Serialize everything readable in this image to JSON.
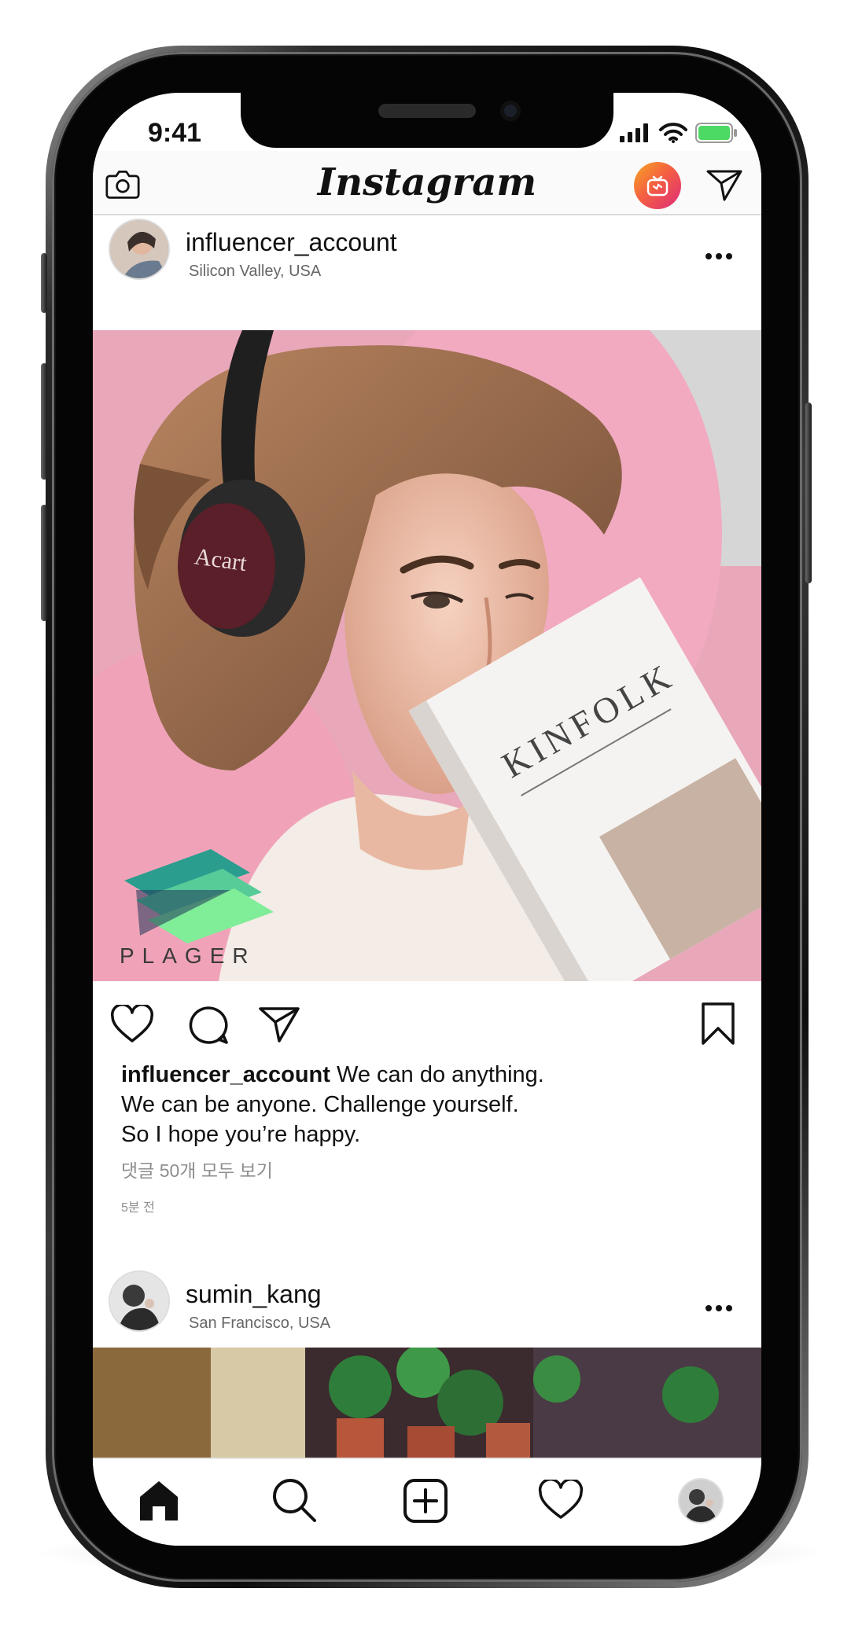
{
  "status_bar": {
    "time": "9:41"
  },
  "top_bar": {
    "logo": "Instagram",
    "icons": [
      "camera-icon",
      "igtv-icon",
      "direct-icon"
    ]
  },
  "post1": {
    "username": "influencer_account",
    "location": "Silicon Valley, USA",
    "more": "•••",
    "photo_text": {
      "headphone_brand": "Acart",
      "magazine": "KINFOLK",
      "watermark": "PLAGER"
    },
    "caption_user": "influencer_account",
    "caption_line1": "We can do anything.",
    "caption_line2": "We can be anyone. Challenge yourself.",
    "caption_line3": "So I hope you’re happy.",
    "comments_link": "댓글 50개 모두 보기",
    "time_ago": "5분 전"
  },
  "post2": {
    "username": "sumin_kang",
    "location": "San Francisco, USA",
    "more": "•••"
  },
  "tab_bar": {
    "items": [
      "home-icon",
      "search-icon",
      "new-post-icon",
      "activity-heart-icon",
      "profile-avatar"
    ]
  },
  "colors": {
    "igtv_gradient_start": "#f58529",
    "igtv_gradient_end": "#dd2a7b",
    "pink_background": "#f0a9bd",
    "battery_green": "#4cd964"
  }
}
